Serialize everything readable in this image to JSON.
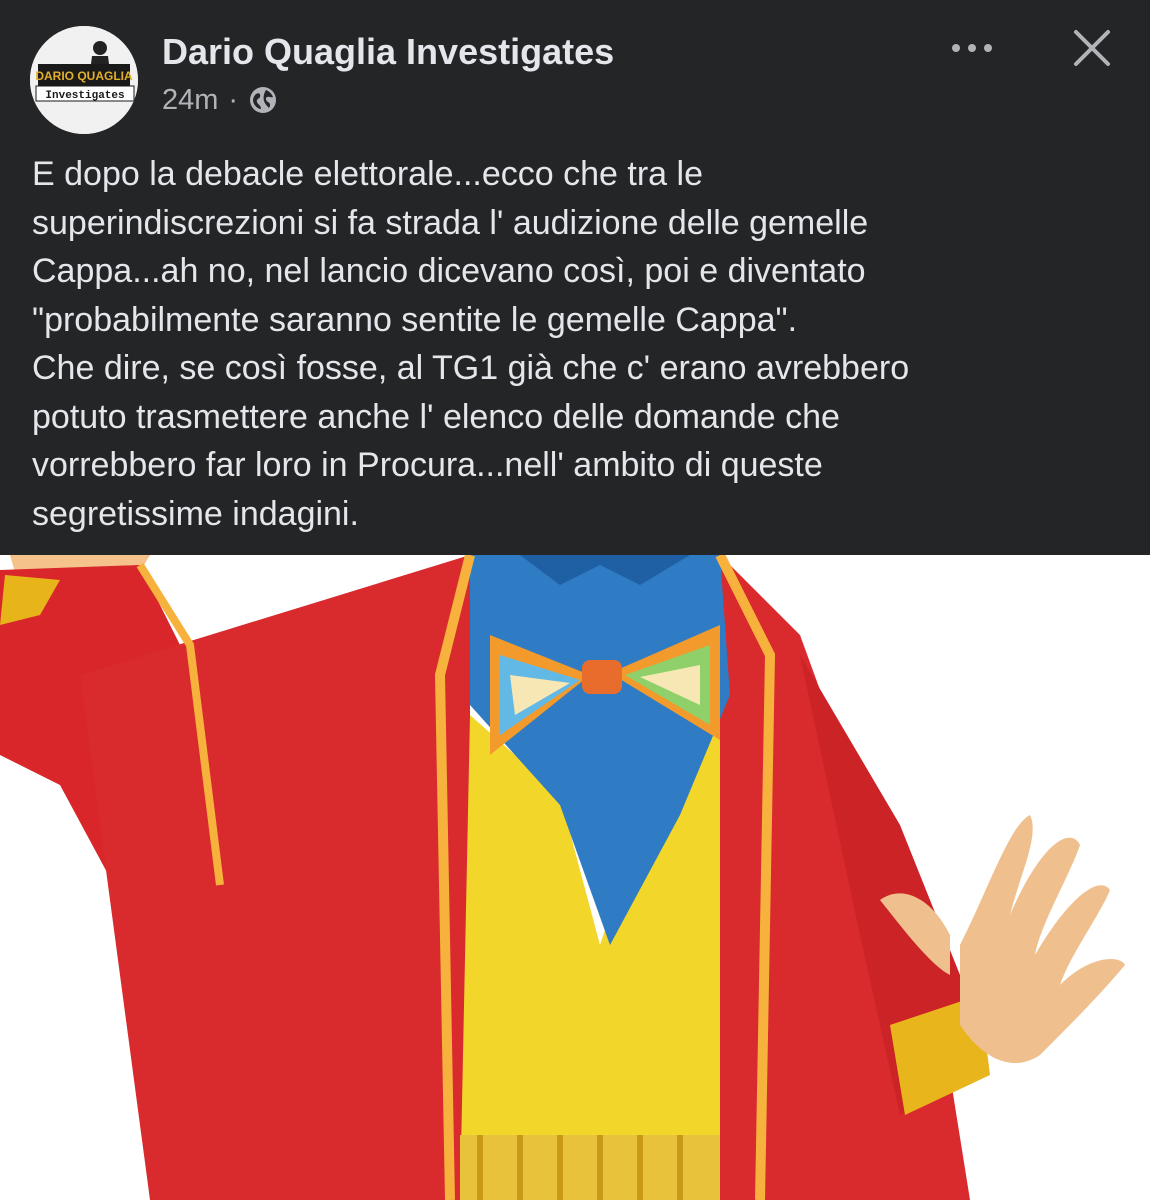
{
  "post": {
    "page_name": "Dario Quaglia Investigates",
    "timestamp": "24m",
    "meta_separator": "·",
    "audience_icon": "globe-icon",
    "more_icon": "more-horizontal-icon",
    "close_icon": "close-icon",
    "avatar": {
      "logo_line1": "DARIO QUAGLIA",
      "logo_line2": "Investigates"
    },
    "text_lines": [
      "E dopo la debacle elettorale...ecco che tra le",
      "superindiscrezioni si fa strada l' audizione delle gemelle",
      "Cappa...ah no, nel lancio dicevano così, poi e diventato",
      "\"probabilmente saranno sentite le gemelle Cappa\".",
      "Che dire, se così fosse, al TG1 già che c' erano avrebbero",
      "potuto trasmettere anche l' elenco delle domande che",
      "vorrebbero far loro in Procura...nell' ambito di queste",
      "segretissime indagini."
    ]
  },
  "colors": {
    "header_background": "#242526",
    "primary_text": "#e4e6eb",
    "secondary_text": "#b0b3b8",
    "photo_background": "#ffffff"
  }
}
